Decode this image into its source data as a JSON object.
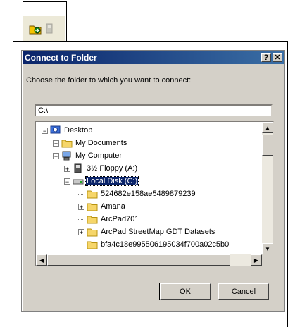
{
  "dialog": {
    "title": "Connect to Folder",
    "help_glyph": "?",
    "close_glyph": "✕",
    "prompt": "Choose the folder to which you want to connect:",
    "path_value": "C:\\",
    "ok_label": "OK",
    "cancel_label": "Cancel"
  },
  "tree": {
    "nodes": [
      {
        "label": "Desktop",
        "icon": "desktop-icon",
        "expander": "−"
      },
      {
        "label": "My Documents",
        "icon": "folder-icon",
        "expander": "+"
      },
      {
        "label": "My Computer",
        "icon": "computer-icon",
        "expander": "−"
      },
      {
        "label": "3½ Floppy (A:)",
        "icon": "floppy-icon",
        "expander": "+"
      },
      {
        "label": "Local Disk (C:)",
        "icon": "drive-icon",
        "expander": "−",
        "selected": true
      },
      {
        "label": "524682e158ae5489879239",
        "icon": "folder-icon",
        "expander": ""
      },
      {
        "label": "Amana",
        "icon": "folder-icon",
        "expander": "+"
      },
      {
        "label": "ArcPad701",
        "icon": "folder-icon",
        "expander": ""
      },
      {
        "label": "ArcPad StreetMap GDT Datasets",
        "icon": "folder-icon",
        "expander": "+"
      },
      {
        "label": "bfa4c18e995506195034f700a02c5b0",
        "icon": "folder-icon",
        "expander": ""
      }
    ]
  },
  "colors": {
    "title_bar": "#0a246a",
    "face": "#d4d0c8",
    "selection": "#0a246a"
  }
}
